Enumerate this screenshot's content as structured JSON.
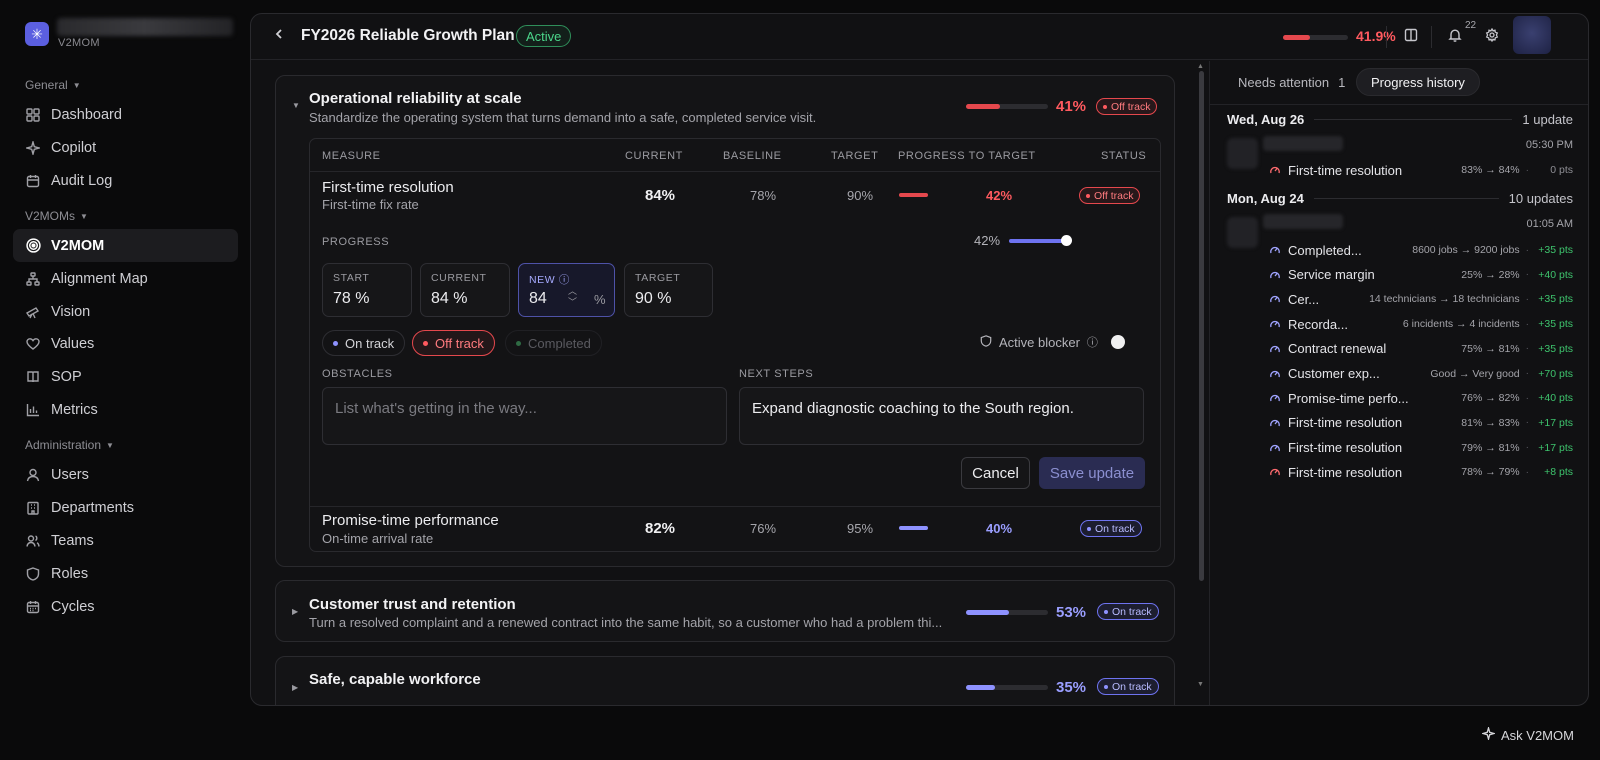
{
  "app": {
    "name": "V2MOM"
  },
  "sidebar": {
    "sections": [
      {
        "label": "General",
        "items": [
          {
            "label": "Dashboard",
            "icon": "grid-icon"
          },
          {
            "label": "Copilot",
            "icon": "sparkle-icon"
          },
          {
            "label": "Audit Log",
            "icon": "calendar-icon"
          }
        ]
      },
      {
        "label": "V2MOMs",
        "items": [
          {
            "label": "V2MOM",
            "icon": "target-icon",
            "active": true
          },
          {
            "label": "Alignment Map",
            "icon": "hierarchy-icon"
          },
          {
            "label": "Vision",
            "icon": "telescope-icon"
          },
          {
            "label": "Values",
            "icon": "heart-icon"
          },
          {
            "label": "SOP",
            "icon": "book-icon"
          },
          {
            "label": "Metrics",
            "icon": "bar-chart-icon"
          }
        ]
      },
      {
        "label": "Administration",
        "items": [
          {
            "label": "Users",
            "icon": "user-icon"
          },
          {
            "label": "Departments",
            "icon": "building-icon"
          },
          {
            "label": "Teams",
            "icon": "users-icon"
          },
          {
            "label": "Roles",
            "icon": "shield-icon"
          },
          {
            "label": "Cycles",
            "icon": "calendar-icon"
          }
        ]
      }
    ]
  },
  "header": {
    "title": "FY2026 Reliable Growth Plan",
    "status": "Active",
    "progress_pct": "41.9%",
    "progress_value": 0.419,
    "notification_count": "22"
  },
  "objectives": [
    {
      "title": "Operational reliability at scale",
      "description": "Standardize the operating system that turns demand into a safe, completed service visit.",
      "pct": "41%",
      "progress_value": 0.41,
      "status": "Off track",
      "expanded": true,
      "table_headers": [
        "MEASURE",
        "CURRENT",
        "BASELINE",
        "TARGET",
        "PROGRESS TO TARGET",
        "STATUS"
      ],
      "measures": [
        {
          "name": "First-time resolution",
          "sub": "First-time fix rate",
          "current": "84%",
          "baseline": "78%",
          "target": "90%",
          "progress": "42%",
          "progress_value": 0.42,
          "status": "Off track"
        },
        {
          "name": "Promise-time performance",
          "sub": "On-time arrival rate",
          "current": "82%",
          "baseline": "76%",
          "target": "95%",
          "progress": "40%",
          "progress_value": 0.4,
          "status": "On track"
        }
      ],
      "editor": {
        "progress_label": "PROGRESS",
        "slider_pct": "42%",
        "slider_value": 0.42,
        "start_label": "START",
        "start_value": "78 %",
        "current_label": "CURRENT",
        "current_value": "84 %",
        "new_label": "NEW",
        "new_value": "84",
        "new_unit": "%",
        "target_label": "TARGET",
        "target_value": "90 %",
        "status_options": [
          "On track",
          "Off track",
          "Completed"
        ],
        "selected_status": "Off track",
        "blocker_label": "Active blocker",
        "obstacles_label": "OBSTACLES",
        "obstacles_placeholder": "List what's getting in the way...",
        "next_steps_label": "NEXT STEPS",
        "next_steps_value": "Expand diagnostic coaching to the South region.",
        "cancel_label": "Cancel",
        "save_label": "Save update"
      }
    },
    {
      "title": "Customer trust and retention",
      "description": "Turn a resolved complaint and a renewed contract into the same habit, so a customer who had a problem thi...",
      "pct": "53%",
      "progress_value": 0.53,
      "status": "On track",
      "expanded": false
    },
    {
      "title": "Safe, capable workforce",
      "description": "",
      "pct": "35%",
      "progress_value": 0.35,
      "status": "On track",
      "expanded": false
    }
  ],
  "right_panel": {
    "tabs": [
      {
        "label": "Needs attention",
        "count": "1"
      },
      {
        "label": "Progress history"
      }
    ],
    "days": [
      {
        "date": "Wed, Aug 26",
        "count": "1 update",
        "time": "05:30 PM",
        "entries": [
          {
            "name": "First-time resolution",
            "change": "83% → 84%",
            "pts": "0 pts",
            "tone": "off"
          }
        ]
      },
      {
        "date": "Mon, Aug 24",
        "count": "10 updates",
        "time": "01:05 AM",
        "entries": [
          {
            "name": "Completed...",
            "change": "8600 jobs → 9200 jobs",
            "pts": "+35 pts",
            "tone": "on"
          },
          {
            "name": "Service margin",
            "change": "25% → 28%",
            "pts": "+40 pts",
            "tone": "on"
          },
          {
            "name": "Cer...",
            "change": "14 technicians → 18 technicians",
            "pts": "+35 pts",
            "tone": "on"
          },
          {
            "name": "Recorda...",
            "change": "6 incidents → 4 incidents",
            "pts": "+35 pts",
            "tone": "on"
          },
          {
            "name": "Contract renewal",
            "change": "75% → 81%",
            "pts": "+35 pts",
            "tone": "on"
          },
          {
            "name": "Customer exp...",
            "change": "Good → Very good",
            "pts": "+70 pts",
            "tone": "on"
          },
          {
            "name": "Promise-time perfo...",
            "change": "76% → 82%",
            "pts": "+40 pts",
            "tone": "on"
          },
          {
            "name": "First-time resolution",
            "change": "81% → 83%",
            "pts": "+17 pts",
            "tone": "on"
          },
          {
            "name": "First-time resolution",
            "change": "79% → 81%",
            "pts": "+17 pts",
            "tone": "on"
          },
          {
            "name": "First-time resolution",
            "change": "78% → 79%",
            "pts": "+8 pts",
            "tone": "off"
          }
        ]
      }
    ]
  },
  "ask_button": "Ask V2MOM",
  "colors": {
    "accent": "#6e73f0",
    "off_track": "#e5484d",
    "active": "#4bd58a",
    "pts_positive": "#3ec46d"
  }
}
